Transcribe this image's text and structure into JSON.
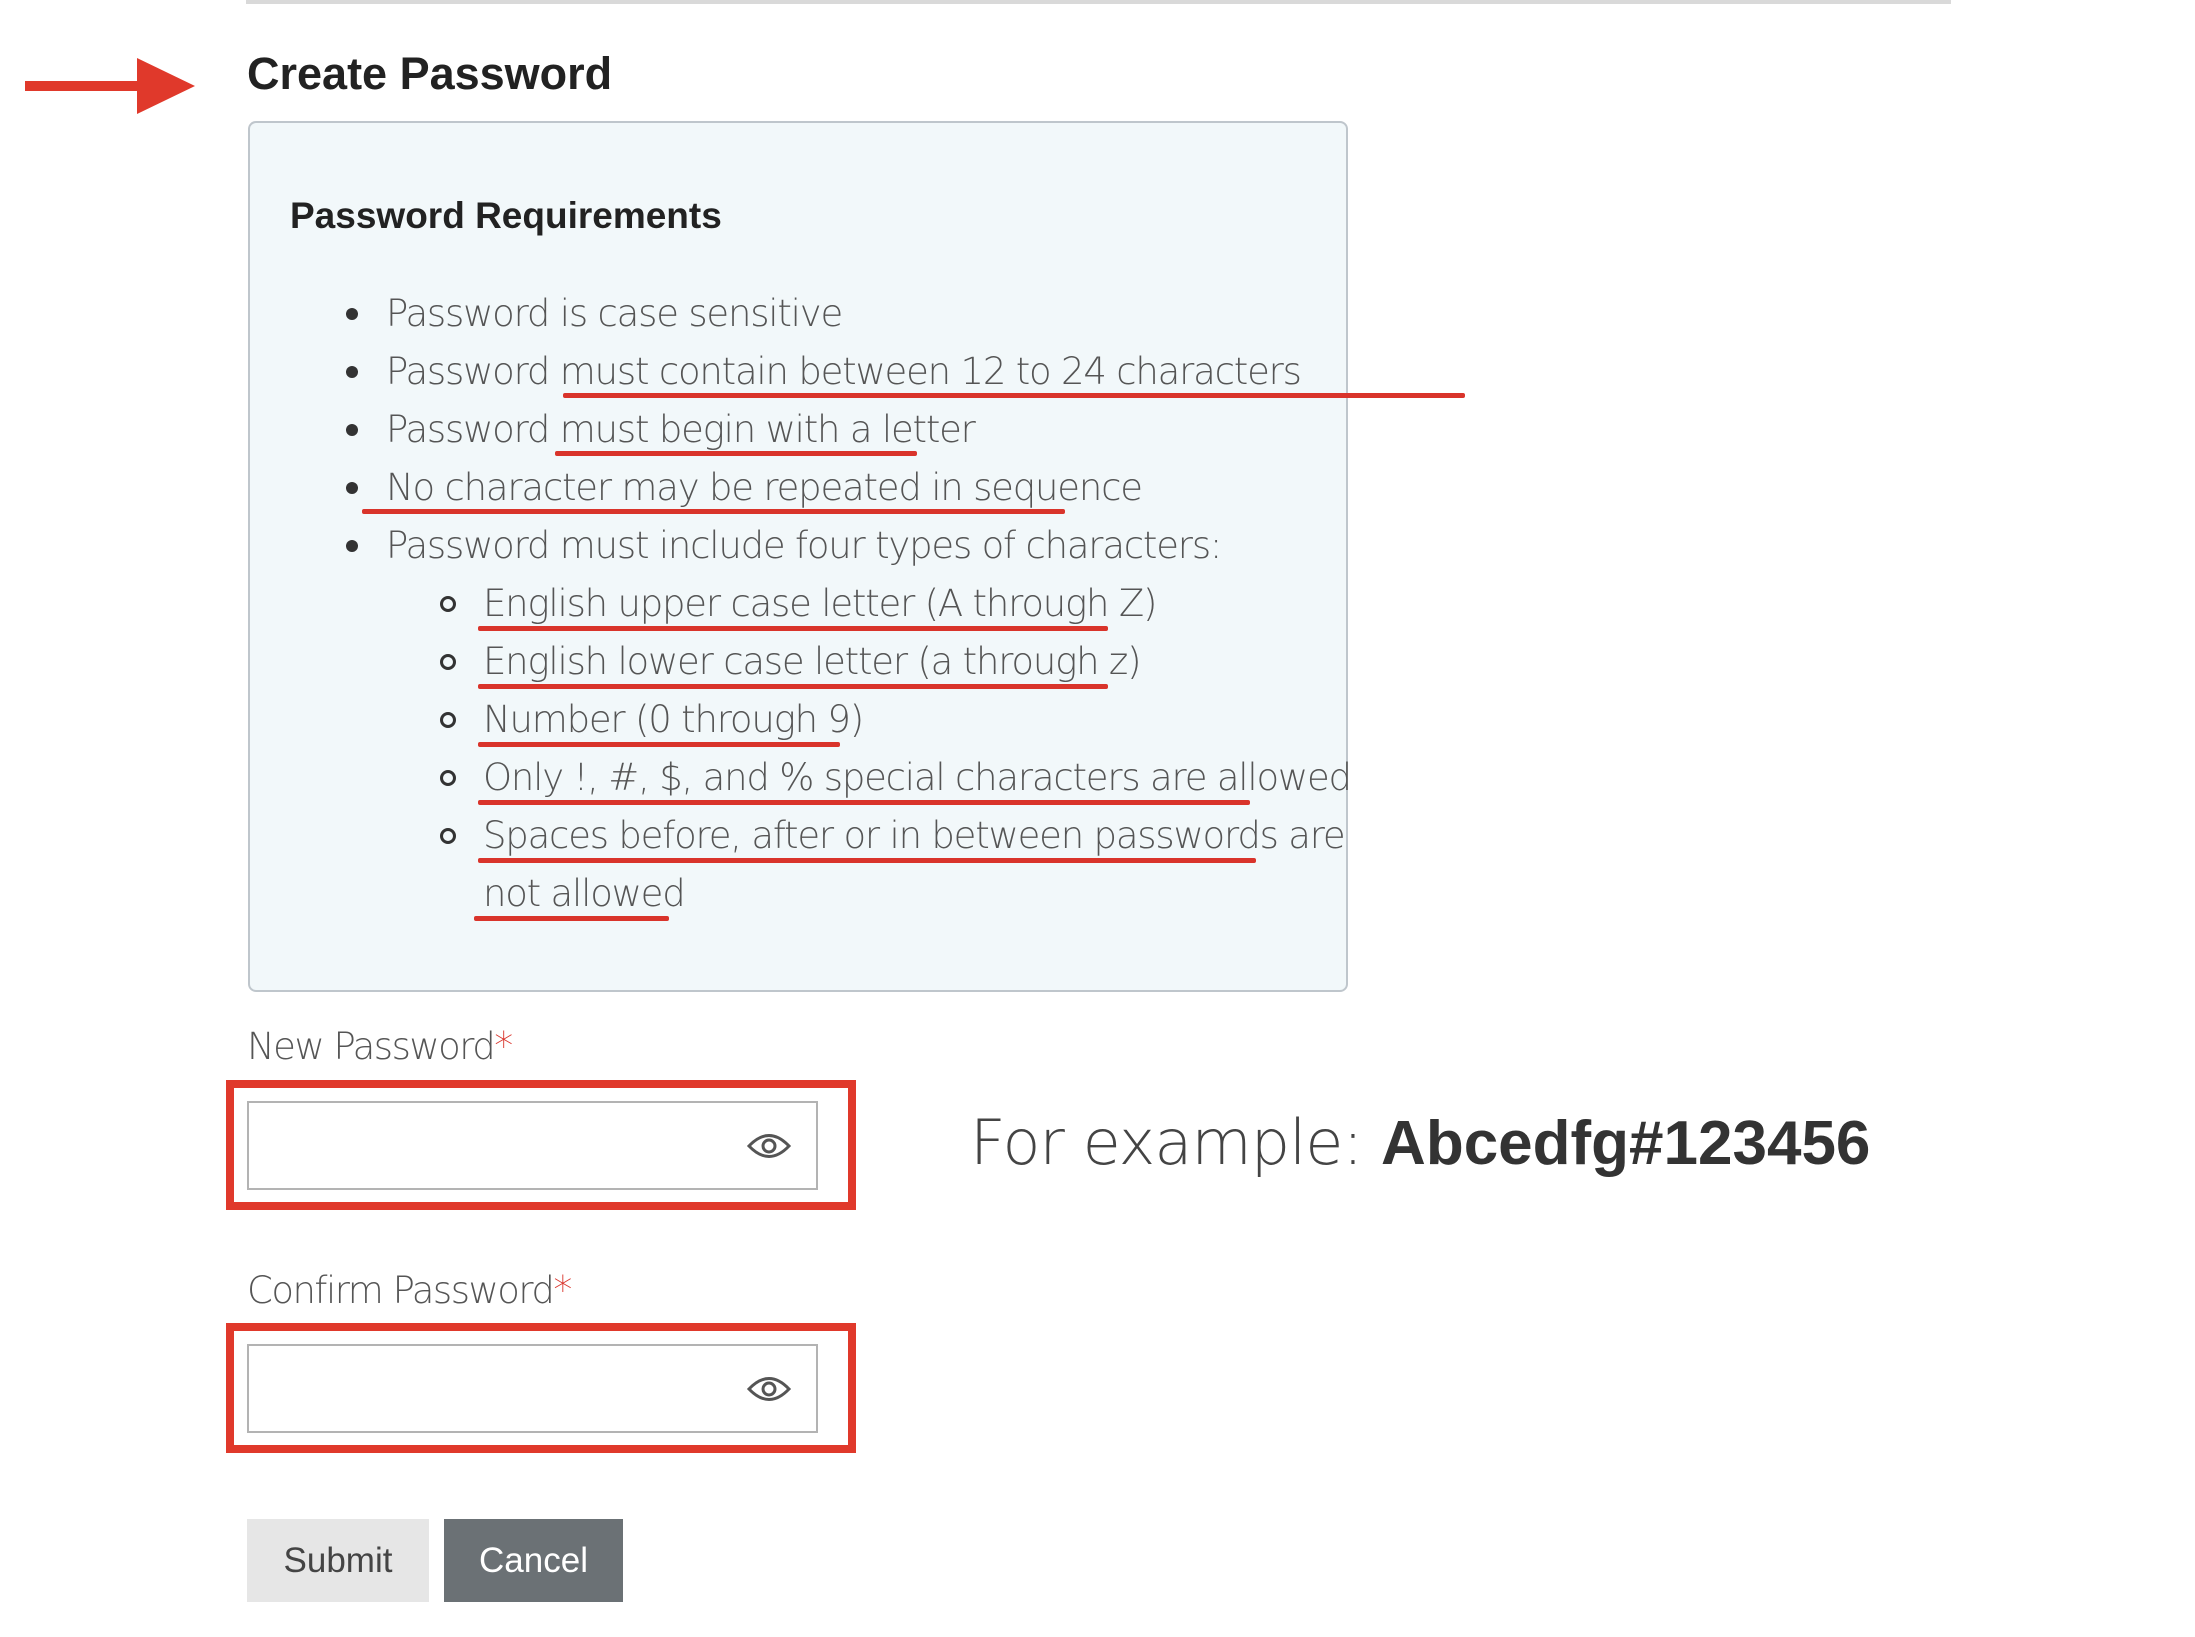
{
  "page": {
    "title": "Create Password",
    "annotation_color": "#e0392b"
  },
  "requirements": {
    "title": "Password Requirements",
    "items": [
      "Password is case sensitive",
      "Password must contain between 12 to 24 characters",
      "Password must begin with a letter",
      "No character may be repeated in sequence",
      "Password must include four types of characters:"
    ],
    "char_types": [
      "English upper case letter (A through Z)",
      "English lower case letter (a through z)",
      "Number (0 through 9)",
      "Only !, #, $, and % special characters are allowed",
      "Spaces before, after or in between passwords are",
      "not allowed"
    ]
  },
  "form": {
    "new_password": {
      "label": "New Password",
      "required_mark": "*",
      "value": "",
      "icon": "eye-icon"
    },
    "confirm_password": {
      "label": "Confirm Password",
      "required_mark": "*",
      "value": "",
      "icon": "eye-icon"
    },
    "example_prefix": "For example: ",
    "example_value": "Abcedfg#123456"
  },
  "buttons": {
    "submit": "Submit",
    "cancel": "Cancel"
  }
}
